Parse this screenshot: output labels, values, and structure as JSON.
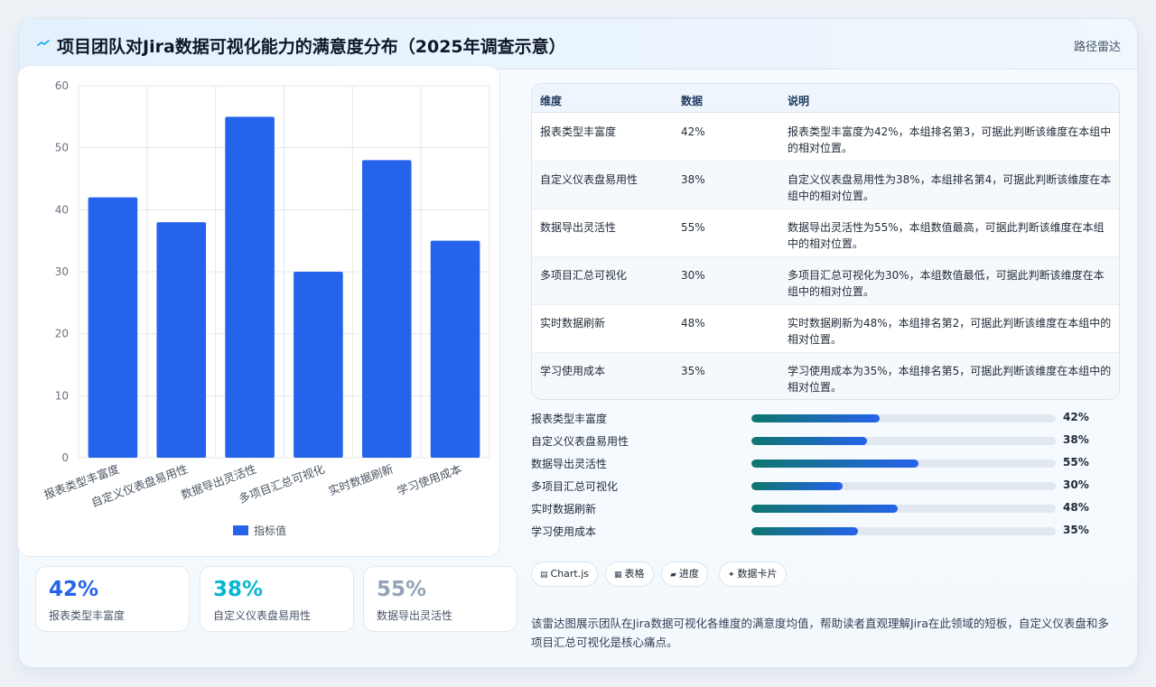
{
  "header": {
    "icon": "pulse-line-icon",
    "title": "项目团队对Jira数据可视化能力的满意度分布（2025年调查示意）",
    "chart_type": "路径雷达"
  },
  "chart_data": {
    "type": "bar",
    "categories": [
      "报表类型丰富度",
      "自定义仪表盘易用性",
      "数据导出灵活性",
      "多项目汇总可视化",
      "实时数据刷新",
      "学习使用成本"
    ],
    "series": [
      {
        "name": "指标值",
        "values": [
          42,
          38,
          55,
          30,
          48,
          35
        ],
        "color": "#2563eb"
      }
    ],
    "yticks": [
      "0",
      "10",
      "20",
      "30",
      "40",
      "50",
      "60"
    ],
    "ylim": [
      0,
      60
    ],
    "grid": true,
    "legend": "bottom"
  },
  "stats": [
    {
      "value": "42%",
      "label": "报表类型丰富度",
      "color": "#2563eb"
    },
    {
      "value": "38%",
      "label": "自定义仪表盘易用性",
      "color": "#06b6d4"
    },
    {
      "value": "55%",
      "label": "数据导出灵活性",
      "color": "#94a3b8"
    }
  ],
  "table": {
    "headers": [
      "维度",
      "数据",
      "说明"
    ],
    "rows": [
      {
        "dim": "报表类型丰富度",
        "val": "42%",
        "desc": "报表类型丰富度为42%，本组排名第3，可据此判断该维度在本组中的相对位置。"
      },
      {
        "dim": "自定义仪表盘易用性",
        "val": "38%",
        "desc": "自定义仪表盘易用性为38%，本组排名第4，可据此判断该维度在本组中的相对位置。"
      },
      {
        "dim": "数据导出灵活性",
        "val": "55%",
        "desc": "数据导出灵活性为55%，本组数值最高，可据此判断该维度在本组中的相对位置。"
      },
      {
        "dim": "多项目汇总可视化",
        "val": "30%",
        "desc": "多项目汇总可视化为30%，本组数值最低，可据此判断该维度在本组中的相对位置。"
      },
      {
        "dim": "实时数据刷新",
        "val": "48%",
        "desc": "实时数据刷新为48%，本组排名第2，可据此判断该维度在本组中的相对位置。"
      },
      {
        "dim": "学习使用成本",
        "val": "35%",
        "desc": "学习使用成本为35%，本组排名第5，可据此判断该维度在本组中的相对位置。"
      }
    ]
  },
  "progress": [
    {
      "label": "报表类型丰富度",
      "pct": "42%",
      "value": 42
    },
    {
      "label": "自定义仪表盘易用性",
      "pct": "38%",
      "value": 38
    },
    {
      "label": "数据导出灵活性",
      "pct": "55%",
      "value": 55
    },
    {
      "label": "多项目汇总可视化",
      "pct": "30%",
      "value": 30
    },
    {
      "label": "实时数据刷新",
      "pct": "48%",
      "value": 48
    },
    {
      "label": "学习使用成本",
      "pct": "35%",
      "value": 35
    }
  ],
  "tags": [
    {
      "icon": "chart-icon",
      "glyph": "▤",
      "label": "Chart.js"
    },
    {
      "icon": "table-icon",
      "glyph": "▦",
      "label": "表格"
    },
    {
      "icon": "progress-icon",
      "glyph": "▰",
      "label": "进度"
    },
    {
      "icon": "card-icon",
      "glyph": "✦",
      "label": "数据卡片"
    }
  ],
  "note": "该雷达图展示团队在Jira数据可视化各维度的满意度均值，帮助读者直观理解Jira在此领域的短板，自定义仪表盘和多项目汇总可视化是核心痛点。"
}
